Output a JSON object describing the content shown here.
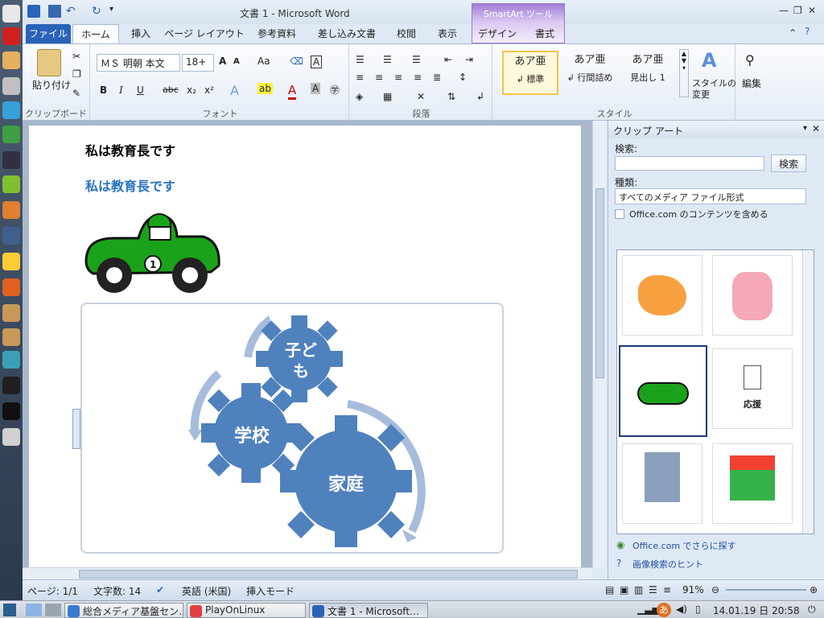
{
  "window": {
    "title": "文書 1 - Microsoft Word",
    "contextual_tab": "SmartArt ツール"
  },
  "tabs": [
    "ファイル",
    "ホーム",
    "挿入",
    "ページ レイアウト",
    "参考資料",
    "差し込み文書",
    "校閲",
    "表示",
    "デザイン",
    "書式"
  ],
  "ribbon": {
    "clipboard": {
      "label": "クリップボード",
      "paste": "貼り付け"
    },
    "font": {
      "label": "フォント",
      "name": "ＭＳ 明朝 本文",
      "size": "18+",
      "aa": "Aa",
      "bold": "B",
      "italic": "I",
      "underline": "U",
      "strike": "abc",
      "sub": "x₂",
      "sup": "x²",
      "grow": "A",
      "shrink": "A"
    },
    "paragraph": {
      "label": "段落"
    },
    "styles": {
      "label": "スタイル",
      "items": [
        {
          "top": "あア亜",
          "bottom": "↲ 標準"
        },
        {
          "top": "あア亜",
          "bottom": "↲ 行間詰め"
        },
        {
          "top": "あア亜",
          "bottom": "見出し 1"
        }
      ],
      "change": "スタイルの\n変更"
    },
    "editing": {
      "label": "編集"
    }
  },
  "document": {
    "heading_black": "私は教育長です",
    "heading_blue": "私は教育長です",
    "gears": [
      {
        "label": "子ど\nも"
      },
      {
        "label": "学校"
      },
      {
        "label": "家庭"
      }
    ]
  },
  "clipart_pane": {
    "title": "クリップ アート",
    "search_label": "検索:",
    "search_value": "",
    "search_button": "検索",
    "type_label": "種類:",
    "type_value": "すべてのメディア ファイル形式",
    "include_office": "Office.com のコンテンツを含める",
    "clip_caption_ouen": "応援",
    "link_more": "Office.com でさらに探す",
    "link_hint": "画像検索のヒント"
  },
  "status": {
    "page": "ページ: 1/1",
    "words": "文字数: 14",
    "lang": "英語 (米国)",
    "mode": "挿入モード",
    "zoom": "91%"
  },
  "taskbar": {
    "items": [
      "総合メディア基盤セン…",
      "PlayOnLinux",
      "文書 1 - Microsoft…"
    ],
    "clock": "14.01.19 日 20:58"
  },
  "colors": {
    "accent": "#2a63b8",
    "gear": "#4f81bd",
    "arrow": "#a7bcdc",
    "car": "#1aa31a"
  }
}
